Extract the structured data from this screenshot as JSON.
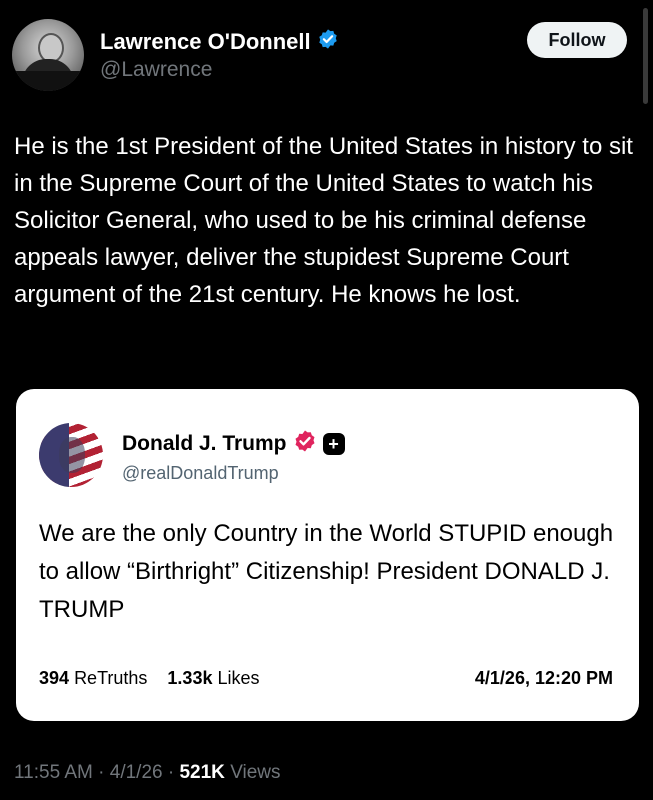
{
  "author": {
    "name": "Lawrence O'Donnell",
    "handle": "@Lawrence",
    "verified_badge_icon": "verified-badge-icon",
    "badge_color": "#1d9bf0"
  },
  "follow_label": "Follow",
  "tweet_text": "He is the 1st President of the United States in history to sit in the Supreme Court of the United States to watch his Solicitor General, who used to be his criminal defense appeals lawyer, deliver the stupidest Supreme Court argument of the 21st century. He knows he lost.",
  "quoted_post": {
    "name": "Donald J. Trump",
    "handle": "@realDonaldTrump",
    "verified_badge_color": "#e0245e",
    "plus_badge": "+",
    "text": "We are the only Country in the World STUPID enough to allow “Birthright” Citizenship! President DONALD J. TRUMP",
    "retruths_count": "394",
    "retruths_label": "ReTruths",
    "likes_count": "1.33k",
    "likes_label": "Likes",
    "date": "4/1/26, 12:20 PM"
  },
  "meta": {
    "time": "11:55 AM",
    "date": "4/1/26",
    "separator": "·",
    "views_count": "521K",
    "views_label": "Views"
  }
}
